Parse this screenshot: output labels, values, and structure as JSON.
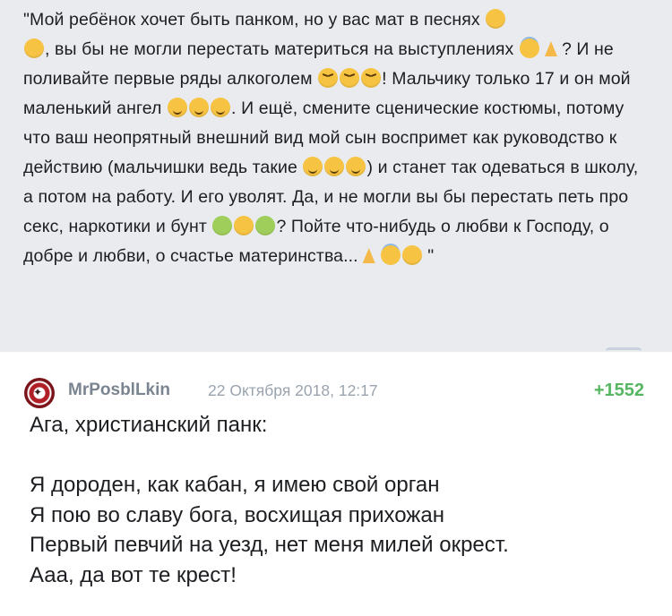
{
  "quote": {
    "segments": [
      "\"Мой ребёнок хочет быть панком, но у вас мат в песнях ",
      ", вы бы не могли перестать материться на выступлениях ",
      "? И не поливайте первые ряды алкоголем ",
      "! Мальчику только 17 и он мой маленький ангел ",
      ". И ещё, смените сценические костюмы, потому что ваш неопрятный внешний вид мой сын воспримет как руководство к действию (мальчишки ведь такие ",
      ") и станет так одеваться в школу, а потом на работу. И его уволят. Да, и не могли вы бы перестать петь про секс, наркотики и бунт ",
      "? Пойте что-нибудь о любви к Господу, о добре и любви, о счастье материнства...",
      " \""
    ],
    "emoji_icons": [
      "screaming-face-icon",
      "disappointed-face-icon",
      "angel-face-icon",
      "praying-hands-icon",
      "angry-face-icon",
      "smiling-face-icon",
      "laughing-face-icon",
      "nauseated-face-icon",
      "vomiting-face-icon",
      "kissing-face-icon"
    ]
  },
  "comment": {
    "author": "MrPosblLkin",
    "timestamp": "22 Октября 2018, 12:17",
    "rating": "+1552",
    "lines": [
      "Ага, христианский панк:",
      "Я дороден, как кабан, я имею свой орган",
      "Я пою во славу бога, восхищая прихожан",
      "Первый певчий на уезд, нет меня милей окрест.",
      "Ааа, да вот те крест!"
    ]
  },
  "colors": {
    "quote_background": "#e9ebee",
    "author": "#7a8591",
    "timestamp": "#9aa4ae",
    "rating": "#57b661",
    "text": "#1c1e21"
  }
}
